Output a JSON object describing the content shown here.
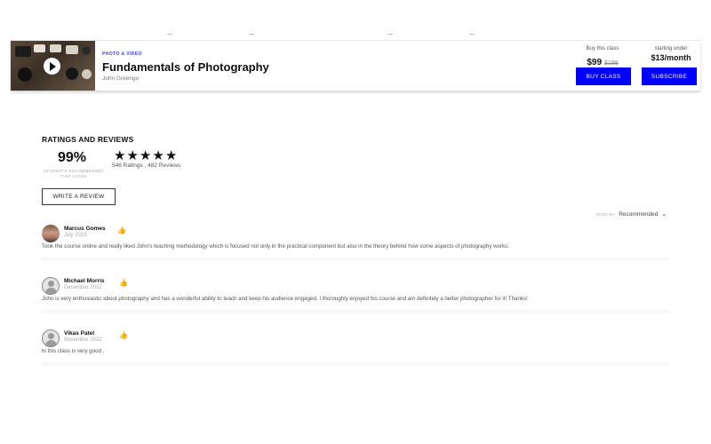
{
  "course": {
    "category": "PHOTO & VIDEO",
    "title": "Fundamentals of Photography",
    "instructor": "John Greengo",
    "buy_label": "Buy this class",
    "price": "$99",
    "old_price": "$199",
    "buy_button": "BUY CLASS",
    "subscribe_label": "starting under",
    "subscribe_price": "$13/month",
    "subscribe_button": "SUBSCRIBE"
  },
  "ratings": {
    "heading": "RATINGS AND REVIEWS",
    "percent": "99%",
    "percent_label": "STUDENTS RECOMMENDED THIS CLASS",
    "star_count": 5,
    "counts": "546 Ratings  ,  482 Reviews",
    "write_button": "WRITE A REVIEW"
  },
  "sort": {
    "label": "SORT BY",
    "value": "Recommended"
  },
  "reviews": [
    {
      "name": "Marcus Gomes",
      "date": "July 2023",
      "avatar": "photo",
      "text": "Took the course online and really liked John's teaching methodology which is focused not only in the practical component but also in the theory behind how some aspects of photography works."
    },
    {
      "name": "Michael Morris",
      "date": "December 2022",
      "avatar": "default",
      "text": "John is very enthusiastic about photography and has a wonderful ability to teach and keep his audience engaged. I thoroughly enjoyed his course and am definitely a better photographer for it! Thanks!"
    },
    {
      "name": "Vikas Patel",
      "date": "November 2022",
      "avatar": "default",
      "text": "hi this class is very good ."
    }
  ],
  "icons": {
    "star": "star-icon",
    "like": "thumbs-up-icon",
    "play": "play-icon",
    "chevron": "chevron-down-icon"
  },
  "colors": {
    "accent": "#0000ff",
    "category": "#3b3bff"
  }
}
